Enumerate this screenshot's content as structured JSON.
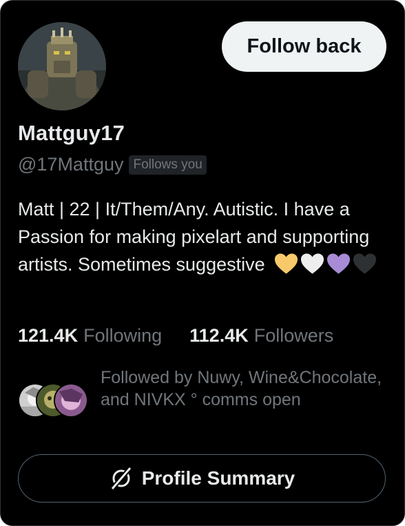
{
  "profile": {
    "display_name": "Mattguy17",
    "handle": "@17Mattguy",
    "follows_you_badge": "Follows you",
    "bio": "Matt | 22 | It/Them/Any. Autistic. I have a Passion for making pixelart and supporting artists. Sometimes suggestive",
    "bio_hearts": [
      {
        "icon": "yellow-heart-icon",
        "color": "#f7c96b"
      },
      {
        "icon": "white-heart-icon",
        "color": "#eeeeee"
      },
      {
        "icon": "purple-heart-icon",
        "color": "#a78bd4"
      },
      {
        "icon": "black-heart-icon",
        "color": "#2e3133"
      }
    ]
  },
  "actions": {
    "follow_back_label": "Follow back",
    "profile_summary_label": "Profile Summary"
  },
  "stats": {
    "following_count": "121.4K",
    "following_label": "Following",
    "followers_count": "112.4K",
    "followers_label": "Followers"
  },
  "followed_by": {
    "text": "Followed by Nuwy, Wine&Chocolate, and NIVKX ° comms open"
  },
  "colors": {
    "background": "#000000",
    "primary_text": "#e7e9ea",
    "secondary_text": "#71767b",
    "follow_button_bg": "#eff3f4",
    "border": "#536471"
  }
}
